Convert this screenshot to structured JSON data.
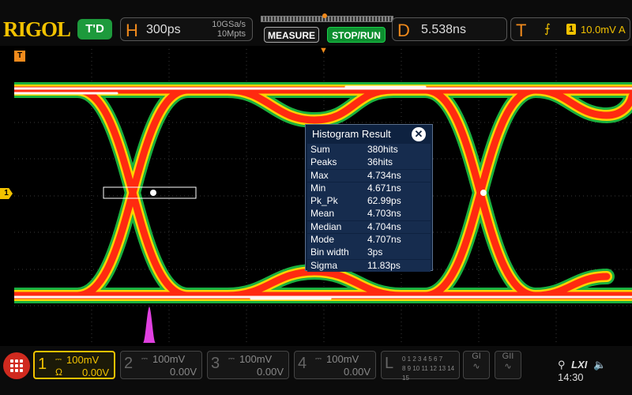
{
  "brand": {
    "logo": "RIGOL",
    "run_state": "T'D"
  },
  "horizontal": {
    "letter": "H",
    "timebase": "300ps",
    "sample_rate": "10GSa/s",
    "memory_depth": "10Mpts"
  },
  "buttons": {
    "measure": "MEASURE",
    "stop_run": "STOP/RUN"
  },
  "delay": {
    "letter": "D",
    "value": "5.538ns"
  },
  "trigger": {
    "letter": "T",
    "edge_symbol": "⨍",
    "source": "1",
    "level": "10.0mV",
    "mode": "A"
  },
  "markers": {
    "trigger_pos": "▼",
    "ch1": "1",
    "top_left": "T"
  },
  "histogram": {
    "title": "Histogram Result",
    "close": "✕",
    "rows": [
      {
        "key": "Sum",
        "value": "380hits"
      },
      {
        "key": "Peaks",
        "value": "36hits"
      },
      {
        "key": "Max",
        "value": "4.734ns"
      },
      {
        "key": "Min",
        "value": "4.671ns"
      },
      {
        "key": "Pk_Pk",
        "value": "62.99ps"
      },
      {
        "key": "Mean",
        "value": "4.703ns"
      },
      {
        "key": "Median",
        "value": "4.704ns"
      },
      {
        "key": "Mode",
        "value": "4.707ns"
      },
      {
        "key": "Bin width",
        "value": "3ps"
      },
      {
        "key": "Sigma",
        "value": "11.83ps"
      }
    ]
  },
  "channels": [
    {
      "num": "1",
      "coupling": "⎓",
      "scale": "100mV",
      "impedance": "Ω",
      "offset": "0.00V"
    },
    {
      "num": "2",
      "coupling": "⎓",
      "scale": "100mV",
      "offset": "0.00V"
    },
    {
      "num": "3",
      "coupling": "⎓",
      "scale": "100mV",
      "offset": "0.00V"
    },
    {
      "num": "4",
      "coupling": "⎓",
      "scale": "100mV",
      "offset": "0.00V"
    }
  ],
  "logic": {
    "label": "L",
    "bits_row1": "0 1 2 3  4 5 6 7",
    "bits_row2": "8 9 10 11 12 13 14 15"
  },
  "gen": {
    "g1": "GI",
    "g2": "GII"
  },
  "status": {
    "usb": "⚲",
    "lxi": "LXI",
    "sound": "🔈",
    "time": "14:30"
  },
  "colors": {
    "ch1": "#f2c200",
    "accent": "#f08a1c",
    "eye_hot": "#ff2a10",
    "eye_core": "#ffffff",
    "eye_warm": "#ffd400",
    "eye_cool": "#1fd04a",
    "histogram": "#e040e0"
  }
}
